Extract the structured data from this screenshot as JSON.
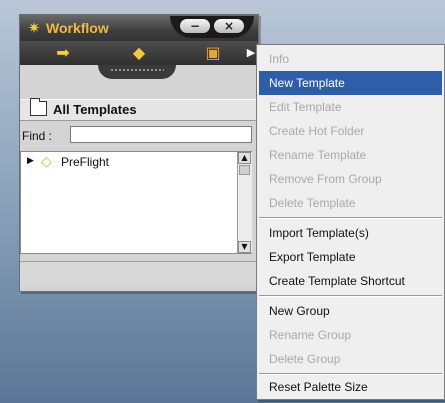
{
  "window": {
    "title": "Workflow",
    "title_icon": "gear-icon",
    "minimize_label": "−",
    "close_label": "×"
  },
  "toolbar": {
    "icons": [
      "move-icon",
      "tag-icon",
      "folder-icon",
      "more-arrow-icon"
    ]
  },
  "section": {
    "title": "All Templates"
  },
  "find": {
    "label": "Find :",
    "value": ""
  },
  "tree": {
    "items": [
      {
        "label": "PreFlight"
      }
    ]
  },
  "menu": {
    "items": [
      {
        "label": "Info",
        "enabled": false
      },
      {
        "label": "New Template",
        "enabled": true,
        "highlighted": true
      },
      {
        "label": "Edit Template",
        "enabled": false
      },
      {
        "label": "Create Hot Folder",
        "enabled": false
      },
      {
        "label": "Rename Template",
        "enabled": false
      },
      {
        "label": "Remove From Group",
        "enabled": false
      },
      {
        "label": "Delete Template",
        "enabled": false
      },
      {
        "label": "Import Template(s)",
        "enabled": true
      },
      {
        "label": "Export Template",
        "enabled": true
      },
      {
        "label": "Create Template Shortcut",
        "enabled": true
      },
      {
        "label": "New Group",
        "enabled": true
      },
      {
        "label": "Rename Group",
        "enabled": false
      },
      {
        "label": "Delete Group",
        "enabled": false
      },
      {
        "label": "Reset Palette Size",
        "enabled": true
      }
    ]
  },
  "colors": {
    "highlight": "#2f5ea8",
    "title_text": "#f4b942",
    "disabled_text": "#a8a8a8"
  }
}
